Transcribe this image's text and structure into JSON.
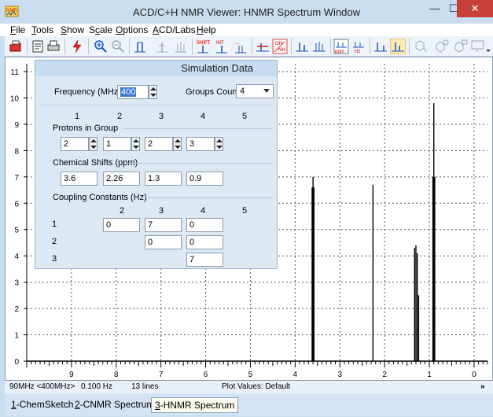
{
  "window": {
    "title": "ACD/C+H NMR Viewer: HNMR Spectrum Window",
    "minimize": "—",
    "maximize": "☐",
    "close": "✕"
  },
  "menu": [
    {
      "label": "File",
      "key": "F"
    },
    {
      "label": "Tools",
      "key": "T"
    },
    {
      "label": "Show",
      "key": "S"
    },
    {
      "label": "Scale",
      "key": "c"
    },
    {
      "label": "Options",
      "key": "O"
    },
    {
      "label": "ACD/Labs",
      "key": "A"
    },
    {
      "label": "Help",
      "key": "H"
    }
  ],
  "toolbar": {
    "icons": [
      "open-icon",
      "print-icon",
      "lightning-icon",
      "zoom-in-icon",
      "zoom-out-icon",
      "peak-icon",
      "peak-dim-icon",
      "peak-mark-icon",
      "shift-icon",
      "int-icon",
      "scale-icon",
      "oh-nh-icon",
      "spectrum-a-icon",
      "spectrum-b-icon",
      "ppm-icon",
      "hz-icon",
      "baseline-icon",
      "baseline-active-icon",
      "molecule-icon",
      "structure-a-icon",
      "structure-b-icon",
      "more-icon"
    ],
    "ppm_label": "ppm",
    "hz_label": "Hz",
    "shift_label": "SHIFT",
    "int_label": "INT",
    "oh_label": "OH",
    "nh_label": "NH"
  },
  "chart_data": {
    "type": "line",
    "xlabel": "",
    "ylabel": "",
    "x_ticks": [
      "9",
      "8",
      "7",
      "6",
      "5",
      "4",
      "3",
      "2",
      "1",
      "0"
    ],
    "y_ticks": [
      "0",
      "1",
      "2",
      "3",
      "4",
      "5",
      "6",
      "7",
      "8",
      "9",
      "10",
      "11"
    ],
    "xlim": [
      10.0,
      -0.3
    ],
    "ylim": [
      0,
      11.3
    ],
    "x_reversed": true,
    "grid": true,
    "peaks": [
      {
        "ppm": 3.62,
        "height": 6.6
      },
      {
        "ppm": 3.6,
        "height": 7.0
      },
      {
        "ppm": 3.58,
        "height": 6.6
      },
      {
        "ppm": 2.26,
        "height": 6.7
      },
      {
        "ppm": 1.33,
        "height": 4.3
      },
      {
        "ppm": 1.3,
        "height": 4.4
      },
      {
        "ppm": 1.27,
        "height": 4.1
      },
      {
        "ppm": 1.24,
        "height": 2.5
      },
      {
        "ppm": 0.92,
        "height": 7.0
      },
      {
        "ppm": 0.9,
        "height": 9.8
      },
      {
        "ppm": 0.88,
        "height": 7.0
      }
    ]
  },
  "sim": {
    "title": "Simulation Data",
    "freq_label": "Frequency (MHz) :",
    "freq_value": "400",
    "groups_label": "Groups Count :",
    "groups_value": "4",
    "cols": [
      "1",
      "2",
      "3",
      "4",
      "5"
    ],
    "protons_label": "Protons in Group",
    "protons": [
      "2",
      "1",
      "2",
      "3"
    ],
    "shifts_label": "Chemical Shifts (ppm)",
    "shifts": [
      "3.6",
      "2.26",
      "1.3",
      "0.9"
    ],
    "coupling_label": "Coupling Constants (Hz)",
    "coupling_cols": [
      "2",
      "3",
      "4",
      "5"
    ],
    "coupling_rows": [
      "1",
      "2",
      "3"
    ],
    "coupling": {
      "r1c2": "0",
      "r1c3": "7",
      "r1c4": "0",
      "r2c3": "0",
      "r2c4": "0",
      "r3c4": "7"
    }
  },
  "status": {
    "freq": "90MHz <400MHz>",
    "res": "0.100 Hz",
    "lines": "13 lines",
    "plot": "Plot Values: Default",
    "more": "»"
  },
  "tabs": [
    {
      "num": "1",
      "label": "-ChemSketch"
    },
    {
      "num": "2",
      "label": "-CNMR Spectrum"
    },
    {
      "num": "3",
      "label": "-HNMR Spectrum"
    }
  ]
}
